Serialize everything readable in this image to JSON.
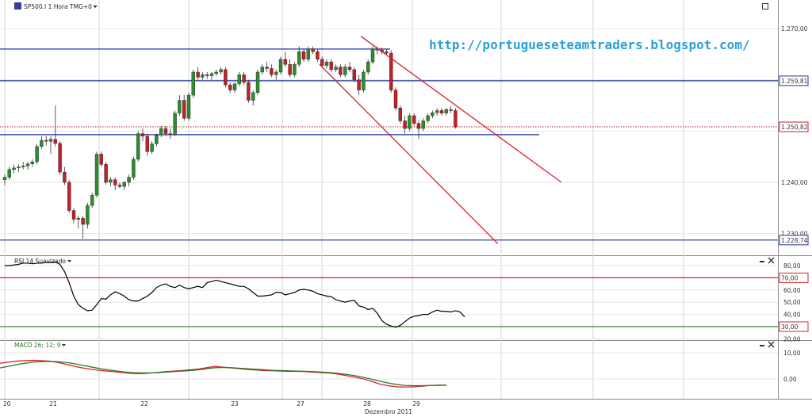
{
  "window": {
    "instrument_label": "SP500.I 1 Hora TMG+0",
    "rsi_label": "RSI 14 Suavizado",
    "macd_label": "MACD 26; 12; 9",
    "watermark_url": "http://portugueseteamtraders.blogspot.com/",
    "month_label": "Dezembro 2011"
  },
  "colors": {
    "up_candle": "#2e8b2e",
    "down_candle": "#c0202a",
    "hline": "#2030a0",
    "channel": "#d8202a",
    "rsi_line": "#000000",
    "rsi_overbought": "#d8202a",
    "rsi_oversold": "#2a8a2a",
    "macd_line": "#d8202a",
    "signal_line": "#2a7a2a"
  },
  "icons": [
    "instrument-icon",
    "maximize-icon",
    "close-icon",
    "dropdown-arrow-icon"
  ],
  "chart_data": [
    {
      "type": "candlestick",
      "title": "SP500.I 1 Hora TMG+0",
      "x_tick_labels": [
        "20",
        "21",
        "22",
        "23",
        "27",
        "28",
        "29"
      ],
      "x_axis_title": "Dezembro 2011",
      "y_tick_labels": [
        "1.270,00",
        "1.240,00",
        "1.230,00"
      ],
      "ylim": [
        1227,
        1274
      ],
      "grid": true,
      "horizontal_levels": [
        {
          "value": 1266.0,
          "labelled": false
        },
        {
          "value": 1259.81,
          "label": "1.259,81"
        },
        {
          "value": 1249.3,
          "labelled": false
        },
        {
          "value": 1228.74,
          "label": "1.228,74"
        }
      ],
      "current_price": {
        "value": 1250.82,
        "label": "1.250,82"
      },
      "candles": [
        [
          1240.5,
          1241.5,
          1239.5,
          1241.0
        ],
        [
          1241.0,
          1243.0,
          1240.5,
          1242.5
        ],
        [
          1242.5,
          1243.5,
          1241.8,
          1242.8
        ],
        [
          1242.8,
          1243.5,
          1242.0,
          1243.0
        ],
        [
          1243.0,
          1244.0,
          1242.5,
          1243.2
        ],
        [
          1243.2,
          1244.0,
          1242.5,
          1243.6
        ],
        [
          1243.6,
          1244.5,
          1243.0,
          1244.0
        ],
        [
          1244.0,
          1247.5,
          1243.5,
          1247.0
        ],
        [
          1247.0,
          1249.0,
          1246.5,
          1248.2
        ],
        [
          1248.2,
          1249.0,
          1247.2,
          1248.0
        ],
        [
          1248.0,
          1249.0,
          1245.5,
          1248.4
        ],
        [
          1248.4,
          1255.0,
          1247.0,
          1247.6
        ],
        [
          1247.6,
          1248.0,
          1241.5,
          1242.0
        ],
        [
          1242.0,
          1243.0,
          1239.5,
          1240.0
        ],
        [
          1240.0,
          1240.5,
          1234.0,
          1234.5
        ],
        [
          1234.5,
          1235.0,
          1232.0,
          1232.8
        ],
        [
          1232.8,
          1233.5,
          1231.0,
          1233.0
        ],
        [
          1233.0,
          1233.5,
          1229.0,
          1231.8
        ],
        [
          1231.8,
          1236.0,
          1231.0,
          1235.5
        ],
        [
          1235.5,
          1238.0,
          1235.0,
          1237.5
        ],
        [
          1237.5,
          1246.0,
          1237.0,
          1245.5
        ],
        [
          1245.5,
          1246.0,
          1243.0,
          1243.5
        ],
        [
          1243.5,
          1244.0,
          1239.5,
          1240.0
        ],
        [
          1240.0,
          1241.0,
          1239.2,
          1240.5
        ],
        [
          1240.5,
          1241.0,
          1238.5,
          1239.5
        ],
        [
          1239.5,
          1240.0,
          1238.8,
          1239.2
        ],
        [
          1239.2,
          1240.2,
          1238.5,
          1240.0
        ],
        [
          1240.0,
          1241.5,
          1239.2,
          1241.0
        ],
        [
          1241.0,
          1245.0,
          1240.5,
          1244.5
        ],
        [
          1244.5,
          1250.0,
          1244.0,
          1249.5
        ],
        [
          1249.5,
          1250.5,
          1248.0,
          1249.0
        ],
        [
          1249.0,
          1249.5,
          1245.2,
          1246.0
        ],
        [
          1246.0,
          1248.0,
          1245.5,
          1247.5
        ],
        [
          1247.5,
          1249.5,
          1247.0,
          1249.2
        ],
        [
          1249.2,
          1251.0,
          1248.8,
          1250.5
        ],
        [
          1250.5,
          1251.0,
          1249.0,
          1249.5
        ],
        [
          1249.5,
          1250.5,
          1248.5,
          1249.3
        ],
        [
          1249.3,
          1254.0,
          1249.0,
          1253.5
        ],
        [
          1253.5,
          1257.0,
          1253.0,
          1256.0
        ],
        [
          1256.0,
          1257.0,
          1252.0,
          1252.5
        ],
        [
          1252.5,
          1257.5,
          1252.0,
          1257.0
        ],
        [
          1257.0,
          1262.0,
          1256.5,
          1261.5
        ],
        [
          1261.5,
          1262.5,
          1260.0,
          1260.5
        ],
        [
          1260.5,
          1261.5,
          1260.0,
          1261.0
        ],
        [
          1261.0,
          1261.5,
          1260.2,
          1260.8
        ],
        [
          1260.8,
          1261.5,
          1260.0,
          1261.2
        ],
        [
          1261.2,
          1262.0,
          1260.8,
          1261.5
        ],
        [
          1261.5,
          1262.5,
          1261.0,
          1262.0
        ],
        [
          1262.0,
          1262.5,
          1258.5,
          1259.0
        ],
        [
          1259.0,
          1259.5,
          1257.5,
          1258.0
        ],
        [
          1258.0,
          1259.5,
          1257.5,
          1259.2
        ],
        [
          1259.2,
          1261.5,
          1258.8,
          1261.0
        ],
        [
          1261.0,
          1261.5,
          1259.0,
          1259.5
        ],
        [
          1259.5,
          1260.0,
          1255.5,
          1256.0
        ],
        [
          1256.0,
          1258.0,
          1255.0,
          1257.5
        ],
        [
          1257.5,
          1262.0,
          1257.0,
          1261.5
        ],
        [
          1261.5,
          1263.0,
          1261.0,
          1262.5
        ],
        [
          1262.5,
          1263.5,
          1261.5,
          1262.2
        ],
        [
          1262.2,
          1263.0,
          1260.5,
          1261.0
        ],
        [
          1261.0,
          1262.0,
          1260.0,
          1261.5
        ],
        [
          1261.5,
          1264.5,
          1261.0,
          1264.0
        ],
        [
          1264.0,
          1265.5,
          1262.5,
          1263.0
        ],
        [
          1263.0,
          1264.0,
          1260.5,
          1261.0
        ],
        [
          1261.0,
          1263.5,
          1260.5,
          1263.0
        ],
        [
          1263.0,
          1266.5,
          1262.5,
          1265.5
        ],
        [
          1265.5,
          1266.0,
          1263.5,
          1264.0
        ],
        [
          1264.0,
          1266.5,
          1263.5,
          1266.0
        ],
        [
          1266.0,
          1266.5,
          1265.0,
          1265.5
        ],
        [
          1265.5,
          1266.0,
          1263.5,
          1264.0
        ],
        [
          1264.0,
          1264.5,
          1262.5,
          1262.8
        ],
        [
          1262.8,
          1264.0,
          1262.2,
          1263.5
        ],
        [
          1263.5,
          1264.0,
          1261.5,
          1262.0
        ],
        [
          1262.0,
          1263.0,
          1261.5,
          1262.5
        ],
        [
          1262.5,
          1263.0,
          1260.5,
          1261.0
        ],
        [
          1261.0,
          1263.0,
          1260.5,
          1262.5
        ],
        [
          1262.5,
          1263.5,
          1261.5,
          1262.0
        ],
        [
          1262.0,
          1262.5,
          1259.5,
          1260.0
        ],
        [
          1260.0,
          1261.0,
          1257.0,
          1258.0
        ],
        [
          1258.0,
          1262.0,
          1257.5,
          1261.5
        ],
        [
          1261.5,
          1264.0,
          1261.0,
          1263.5
        ],
        [
          1263.5,
          1266.5,
          1263.0,
          1266.0
        ],
        [
          1266.0,
          1266.5,
          1265.0,
          1265.8
        ],
        [
          1265.8,
          1266.3,
          1265.0,
          1265.5
        ],
        [
          1265.5,
          1266.0,
          1264.8,
          1265.2
        ],
        [
          1265.2,
          1265.8,
          1257.5,
          1258.0
        ],
        [
          1258.0,
          1258.5,
          1254.0,
          1254.5
        ],
        [
          1254.5,
          1255.0,
          1251.5,
          1252.0
        ],
        [
          1252.0,
          1253.0,
          1249.5,
          1250.5
        ],
        [
          1250.5,
          1253.5,
          1250.0,
          1253.0
        ],
        [
          1253.0,
          1253.5,
          1251.0,
          1251.5
        ],
        [
          1251.5,
          1252.0,
          1248.5,
          1250.5
        ],
        [
          1250.5,
          1252.5,
          1250.0,
          1252.0
        ],
        [
          1252.0,
          1253.5,
          1251.5,
          1253.0
        ],
        [
          1253.0,
          1254.0,
          1252.5,
          1253.6
        ],
        [
          1253.6,
          1254.5,
          1253.0,
          1254.0
        ],
        [
          1254.0,
          1254.5,
          1253.0,
          1253.5
        ],
        [
          1253.5,
          1254.5,
          1253.0,
          1254.2
        ],
        [
          1254.2,
          1254.8,
          1253.5,
          1254.0
        ],
        [
          1254.0,
          1254.5,
          1250.5,
          1250.8
        ]
      ],
      "channel_lines": [
        {
          "from": [
            1,
            1268.5
          ],
          "to": [
            1,
            1240.0
          ]
        },
        {
          "from": [
            1,
            1263.0
          ],
          "to": [
            1,
            1228.0
          ]
        }
      ]
    },
    {
      "type": "line",
      "title": "RSI 14 Suavizado",
      "y_tick_labels": [
        "80,00",
        "70,00",
        "60,00",
        "50,00",
        "40,00",
        "30,00",
        "20,00"
      ],
      "ylim": [
        20,
        84
      ],
      "levels": [
        {
          "value": 70,
          "label": "70,00"
        },
        {
          "value": 30,
          "label": "30,00"
        }
      ],
      "values": [
        80,
        80,
        80.5,
        81,
        82,
        82,
        81.5,
        82,
        82,
        82.5,
        82.5,
        83,
        81,
        75,
        66,
        55,
        48,
        45,
        43,
        43.5,
        48,
        53,
        52.5,
        56,
        58.5,
        57,
        55,
        52,
        51,
        51,
        53,
        55,
        58,
        62,
        64,
        65,
        63,
        62,
        64,
        62,
        61,
        62,
        63,
        62,
        66,
        67,
        68,
        67,
        66,
        65,
        64,
        63,
        63,
        61,
        58,
        55,
        55,
        55.5,
        56,
        58,
        58,
        56,
        57,
        58,
        60,
        60.5,
        60,
        59,
        57,
        56,
        55,
        54.5,
        52,
        51,
        50,
        51,
        51.5,
        47,
        46,
        44,
        45,
        41,
        35,
        32,
        30.5,
        29.5,
        31,
        34,
        37,
        38.5,
        39,
        40,
        40,
        42,
        43.5,
        42.5,
        42.5,
        42,
        43,
        42,
        38
      ]
    },
    {
      "type": "line",
      "title": "MACD 26; 12; 9",
      "y_tick_labels": [
        "10,00",
        "0,00"
      ],
      "ylim": [
        -7,
        15
      ],
      "series": [
        {
          "values": [
            6.0,
            6.4,
            6.8,
            7.0,
            7.1,
            7.0,
            6.8,
            6.3,
            5.6,
            4.8,
            4.2,
            3.7,
            3.3,
            3.0,
            2.7,
            2.4,
            2.1,
            2.0,
            2.2,
            2.5,
            2.8,
            3.0,
            3.2,
            3.5,
            3.8,
            4.3,
            4.8,
            4.5,
            4.2,
            3.9,
            3.6,
            3.4,
            3.2,
            3.1,
            3.0,
            2.9,
            2.9,
            2.8,
            2.6,
            2.4,
            2.2,
            1.8,
            1.2,
            0.6,
            0.0,
            -1.0,
            -2.0,
            -2.6,
            -3.0,
            -3.1,
            -3.0,
            -2.8,
            -2.5,
            -2.4,
            -2.4
          ]
        },
        {
          "values": [
            4.2,
            4.8,
            5.5,
            6.0,
            6.4,
            6.6,
            6.7,
            6.6,
            6.3,
            5.8,
            5.2,
            4.6,
            4.0,
            3.5,
            3.1,
            2.7,
            2.4,
            2.3,
            2.3,
            2.4,
            2.6,
            2.8,
            3.0,
            3.2,
            3.5,
            3.9,
            4.3,
            4.4,
            4.3,
            4.1,
            3.9,
            3.7,
            3.5,
            3.3,
            3.2,
            3.1,
            3.0,
            2.9,
            2.8,
            2.6,
            2.4,
            2.1,
            1.7,
            1.2,
            0.6,
            -0.1,
            -0.9,
            -1.6,
            -2.1,
            -2.5,
            -2.6,
            -2.6,
            -2.5,
            -2.4,
            -2.4
          ]
        }
      ]
    }
  ]
}
